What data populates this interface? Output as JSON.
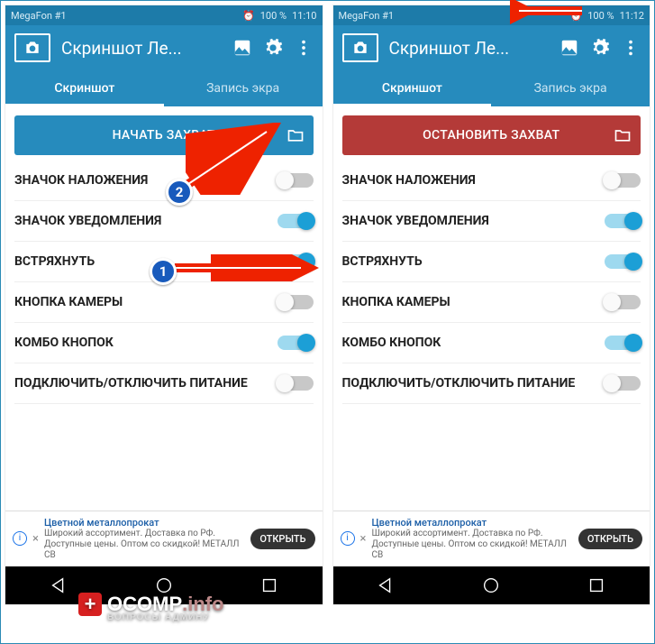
{
  "watermark": {
    "main": "OCOMP",
    "suffix": ".info",
    "sub": "ВОПРОСЫ АДМИНУ"
  },
  "markers": {
    "1": "1",
    "2": "2"
  },
  "left": {
    "statusbar": {
      "carrier": "MegaFon #1",
      "battery": "100 %",
      "time": "11:10",
      "alarm": "⏰"
    },
    "app": {
      "title": "Скриншот Ле..."
    },
    "tabs": {
      "active": "Скриншот",
      "inactive": "Запись экра"
    },
    "capture": {
      "label": "НАЧАТЬ ЗАХВАТ"
    },
    "rows": [
      {
        "label": "ЗНАЧОК НАЛОЖЕНИЯ",
        "on": false
      },
      {
        "label": "ЗНАЧОК УВЕДОМЛЕНИЯ",
        "on": true
      },
      {
        "label": "ВСТРЯХНУТЬ",
        "on": true
      },
      {
        "label": "КНОПКА КАМЕРЫ",
        "on": false
      },
      {
        "label": "КОМБО КНОПОК",
        "on": true
      },
      {
        "label": "ПОДКЛЮЧИТЬ/ОТКЛЮЧИТЬ ПИТАНИЕ",
        "on": false
      }
    ],
    "ad": {
      "title": "Цветной металлопрокат",
      "desc": "Широкий ассортимент. Доставка по РФ. Доступные цены. Оптом со скидкой! МЕТАЛЛ СВ",
      "cta": "ОТКРЫТЬ"
    }
  },
  "right": {
    "statusbar": {
      "carrier": "MegaFon #1",
      "battery": "100 %",
      "time": "11:12",
      "alarm": "⏰"
    },
    "app": {
      "title": "Скриншот Ле..."
    },
    "tabs": {
      "active": "Скриншот",
      "inactive": "Запись экра"
    },
    "capture": {
      "label": "ОСТАНОВИТЬ ЗАХВАТ"
    },
    "rows": [
      {
        "label": "ЗНАЧОК НАЛОЖЕНИЯ",
        "on": false
      },
      {
        "label": "ЗНАЧОК УВЕДОМЛЕНИЯ",
        "on": true
      },
      {
        "label": "ВСТРЯХНУТЬ",
        "on": true
      },
      {
        "label": "КНОПКА КАМЕРЫ",
        "on": false
      },
      {
        "label": "КОМБО КНОПОК",
        "on": true
      },
      {
        "label": "ПОДКЛЮЧИТЬ/ОТКЛЮЧИТЬ ПИТАНИЕ",
        "on": false
      }
    ],
    "ad": {
      "title": "Цветной металлопрокат",
      "desc": "Широкий ассортимент. Доставка по РФ. Доступные цены. Оптом со скидкой! МЕТАЛЛ СВ",
      "cta": "ОТКРЫТЬ"
    }
  }
}
